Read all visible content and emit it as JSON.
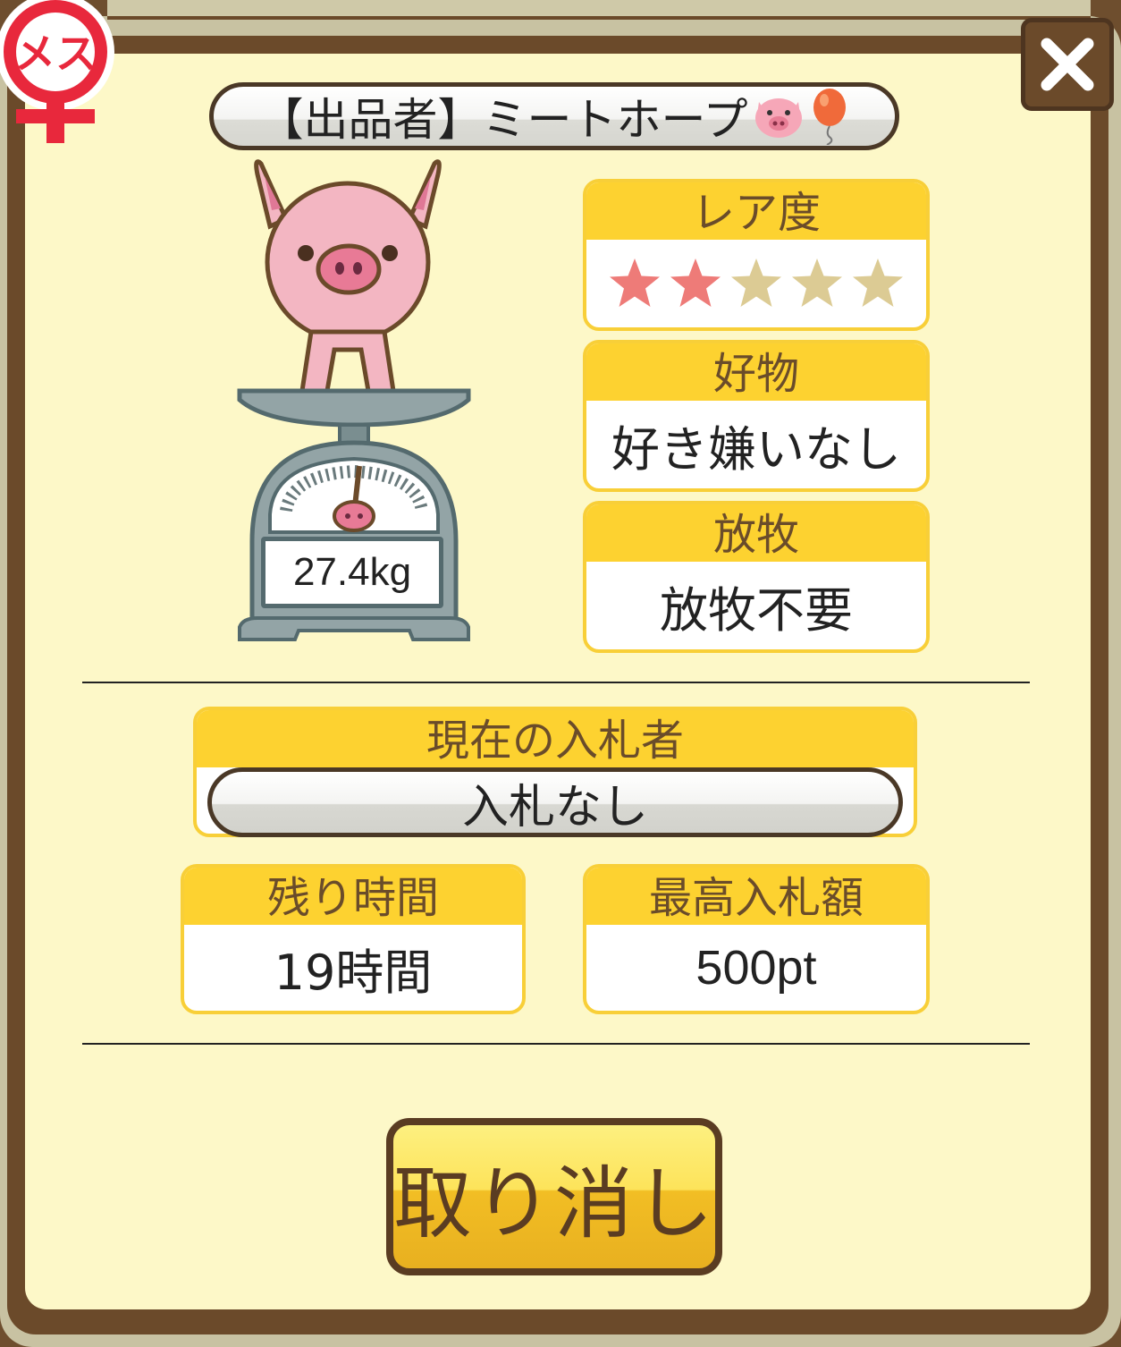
{
  "gender": {
    "label": "メス",
    "color": "#e8283c"
  },
  "seller": {
    "text": "【出品者】ミートホープ",
    "icons": [
      "pig-face",
      "balloon"
    ]
  },
  "pig": {
    "weight": "27.4kg"
  },
  "rarity": {
    "header": "レア度",
    "filled": 2,
    "total": 5,
    "filled_color": "#ee7b78",
    "empty_color": "#dccb94"
  },
  "favorite": {
    "header": "好物",
    "value": "好き嫌いなし"
  },
  "grazing": {
    "header": "放牧",
    "value": "放牧不要"
  },
  "bidder": {
    "header": "現在の入札者",
    "value": "入札なし"
  },
  "remaining": {
    "header": "残り時間",
    "value": "19時間"
  },
  "highest_bid": {
    "header": "最高入札額",
    "value": "500pt"
  },
  "cancel": {
    "label": "取り消し"
  },
  "colors": {
    "panel": "#fdf8c8",
    "frame": "#6b4a2a",
    "card_header": "#fdd230",
    "button": "#f2be24"
  }
}
